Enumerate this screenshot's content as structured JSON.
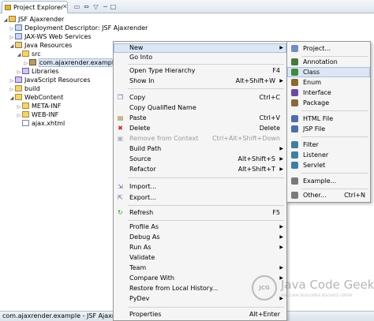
{
  "explorer": {
    "tab_label": "Project Explorer",
    "tab_close": "✕",
    "toolbar": [
      "▭",
      "⇔",
      "▽",
      "─",
      "□"
    ],
    "tree": [
      {
        "label": "JSF Ajaxrender",
        "icon": "project-icon",
        "twisty": "◢"
      },
      {
        "label": "Deployment Descriptor: JSF Ajaxrender",
        "icon": "descriptor-icon",
        "twisty": "▷"
      },
      {
        "label": "JAX-WS Web Services",
        "icon": "webservices-icon",
        "twisty": "▷"
      },
      {
        "label": "Java Resources",
        "icon": "java-resources-icon",
        "twisty": "◢"
      },
      {
        "label": "src",
        "icon": "source-folder-icon",
        "twisty": "◢"
      },
      {
        "label": "com.ajaxrender.example",
        "icon": "package-icon",
        "twisty": "▷"
      },
      {
        "label": "Libraries",
        "icon": "libraries-icon",
        "twisty": "▷"
      },
      {
        "label": "JavaScript Resources",
        "icon": "javascript-resources-icon",
        "twisty": "▷"
      },
      {
        "label": "build",
        "icon": "folder-icon",
        "twisty": "▷"
      },
      {
        "label": "WebContent",
        "icon": "folder-icon",
        "twisty": "◢"
      },
      {
        "label": "META-INF",
        "icon": "folder-icon",
        "twisty": "▷"
      },
      {
        "label": "WEB-INF",
        "icon": "folder-icon",
        "twisty": "▷"
      },
      {
        "label": "ajax.xhtml",
        "icon": "xhtml-file-icon",
        "twisty": ""
      }
    ],
    "status": "com.ajaxrender.example - JSF Ajaxrender"
  },
  "context_menu": {
    "items": [
      {
        "label": "New",
        "accel": "",
        "submenu": true,
        "disabled": false,
        "highlighted": true,
        "icon": ""
      },
      {
        "label": "Go Into",
        "accel": "",
        "submenu": false,
        "disabled": false,
        "highlighted": false,
        "icon": ""
      },
      {
        "label": "Open Type Hierarchy",
        "accel": "F4",
        "submenu": false,
        "disabled": false,
        "highlighted": false,
        "icon": ""
      },
      {
        "label": "Show In",
        "accel": "Alt+Shift+W",
        "submenu": true,
        "disabled": false,
        "highlighted": false,
        "icon": ""
      },
      {
        "label": "Copy",
        "accel": "Ctrl+C",
        "submenu": false,
        "disabled": false,
        "highlighted": false,
        "icon": "copy-icon"
      },
      {
        "label": "Copy Qualified Name",
        "accel": "",
        "submenu": false,
        "disabled": false,
        "highlighted": false,
        "icon": ""
      },
      {
        "label": "Paste",
        "accel": "Ctrl+V",
        "submenu": false,
        "disabled": false,
        "highlighted": false,
        "icon": "paste-icon"
      },
      {
        "label": "Delete",
        "accel": "Delete",
        "submenu": false,
        "disabled": false,
        "highlighted": false,
        "icon": "delete-icon"
      },
      {
        "label": "Remove from Context",
        "accel": "Ctrl+Alt+Shift+Down",
        "submenu": false,
        "disabled": true,
        "highlighted": false,
        "icon": "remove-context-icon"
      },
      {
        "label": "Build Path",
        "accel": "",
        "submenu": true,
        "disabled": false,
        "highlighted": false,
        "icon": ""
      },
      {
        "label": "Source",
        "accel": "Alt+Shift+S",
        "submenu": true,
        "disabled": false,
        "highlighted": false,
        "icon": ""
      },
      {
        "label": "Refactor",
        "accel": "Alt+Shift+T",
        "submenu": true,
        "disabled": false,
        "highlighted": false,
        "icon": ""
      },
      {
        "label": "Import...",
        "accel": "",
        "submenu": false,
        "disabled": false,
        "highlighted": false,
        "icon": "import-icon"
      },
      {
        "label": "Export...",
        "accel": "",
        "submenu": false,
        "disabled": false,
        "highlighted": false,
        "icon": "export-icon"
      },
      {
        "label": "Refresh",
        "accel": "F5",
        "submenu": false,
        "disabled": false,
        "highlighted": false,
        "icon": "refresh-icon"
      },
      {
        "label": "Profile As",
        "accel": "",
        "submenu": true,
        "disabled": false,
        "highlighted": false,
        "icon": ""
      },
      {
        "label": "Debug As",
        "accel": "",
        "submenu": true,
        "disabled": false,
        "highlighted": false,
        "icon": ""
      },
      {
        "label": "Run As",
        "accel": "",
        "submenu": true,
        "disabled": false,
        "highlighted": false,
        "icon": ""
      },
      {
        "label": "Validate",
        "accel": "",
        "submenu": false,
        "disabled": false,
        "highlighted": false,
        "icon": ""
      },
      {
        "label": "Team",
        "accel": "",
        "submenu": true,
        "disabled": false,
        "highlighted": false,
        "icon": ""
      },
      {
        "label": "Compare With",
        "accel": "",
        "submenu": true,
        "disabled": false,
        "highlighted": false,
        "icon": ""
      },
      {
        "label": "Restore from Local History...",
        "accel": "",
        "submenu": false,
        "disabled": false,
        "highlighted": false,
        "icon": ""
      },
      {
        "label": "PyDev",
        "accel": "",
        "submenu": true,
        "disabled": false,
        "highlighted": false,
        "icon": ""
      },
      {
        "label": "Properties",
        "accel": "Alt+Enter",
        "submenu": false,
        "disabled": false,
        "highlighted": false,
        "icon": ""
      }
    ]
  },
  "submenu": {
    "items": [
      {
        "label": "Project...",
        "accel": "",
        "icon": "project-wizard-icon",
        "color": "#6f8fbf",
        "highlighted": false
      },
      {
        "label": "Annotation",
        "accel": "",
        "icon": "annotation-icon",
        "color": "#4a7a3a",
        "highlighted": false
      },
      {
        "label": "Class",
        "accel": "",
        "icon": "class-icon",
        "color": "#3e8a3e",
        "highlighted": true
      },
      {
        "label": "Enum",
        "accel": "",
        "icon": "enum-icon",
        "color": "#8a6a2a",
        "highlighted": false
      },
      {
        "label": "Interface",
        "accel": "",
        "icon": "interface-icon",
        "color": "#6a4aa0",
        "highlighted": false
      },
      {
        "label": "Package",
        "accel": "",
        "icon": "package-icon",
        "color": "#8a6a3a",
        "highlighted": false
      },
      {
        "label": "HTML File",
        "accel": "",
        "icon": "html-file-icon",
        "color": "#4d6fa8",
        "highlighted": false
      },
      {
        "label": "JSP File",
        "accel": "",
        "icon": "jsp-file-icon",
        "color": "#4d6fa8",
        "highlighted": false
      },
      {
        "label": "Filter",
        "accel": "",
        "icon": "filter-icon",
        "color": "#3f7f9f",
        "highlighted": false
      },
      {
        "label": "Listener",
        "accel": "",
        "icon": "listener-icon",
        "color": "#3f7f9f",
        "highlighted": false
      },
      {
        "label": "Servlet",
        "accel": "",
        "icon": "servlet-icon",
        "color": "#3f7f9f",
        "highlighted": false
      },
      {
        "label": "Example...",
        "accel": "",
        "icon": "example-icon",
        "color": "#7a7a7a",
        "highlighted": false
      },
      {
        "label": "Other...",
        "accel": "Ctrl+N",
        "icon": "other-wizard-icon",
        "color": "#7a7a7a",
        "highlighted": false
      }
    ]
  },
  "watermark": {
    "seal": "JCG",
    "brand": "Java Code Geeks",
    "tagline": "JAVA 2 JAVA DEVELOPERS RESOURCE CENTER"
  }
}
